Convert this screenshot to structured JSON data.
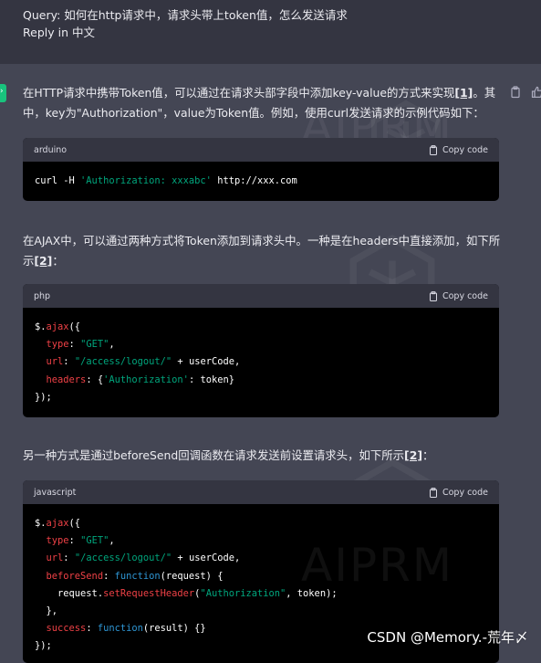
{
  "query": {
    "line1": "Query: 如何在http请求中，请求头带上token值，怎么发送请求",
    "line2": "Reply in 中文"
  },
  "answer": {
    "para1_a": "在HTTP请求中携带Token值，可以通过在请求头部字段中添加key-value的方式来实现",
    "para1_ref": "[1]",
    "para1_b": "。其中，key为\"Authorization\"，value为Token值。例如，使用curl发送请求的示例代码如下：",
    "para2_a": "在AJAX中，可以通过两种方式将Token添加到请求头中。一种是在headers中直接添加，如下所示",
    "para2_ref": "[2]",
    "para2_b": "：",
    "para3_a": "另一种方式是通过beforeSend回调函数在请求发送前设置请求头，如下所示",
    "para3_ref": "[2]",
    "para3_b": "："
  },
  "code_blocks": {
    "copy_label": "Copy code",
    "b1_lang": "arduino",
    "b2_lang": "php",
    "b3_lang": "javascript"
  },
  "watermark": {
    "text": "AIPRM"
  },
  "footer": {
    "csdn": "CSDN @Memory.-荒年〆"
  },
  "colors": {
    "accent": "#19c37d",
    "string": "#00a67d",
    "keyword": "#ef4146",
    "function": "#2e95d3"
  }
}
